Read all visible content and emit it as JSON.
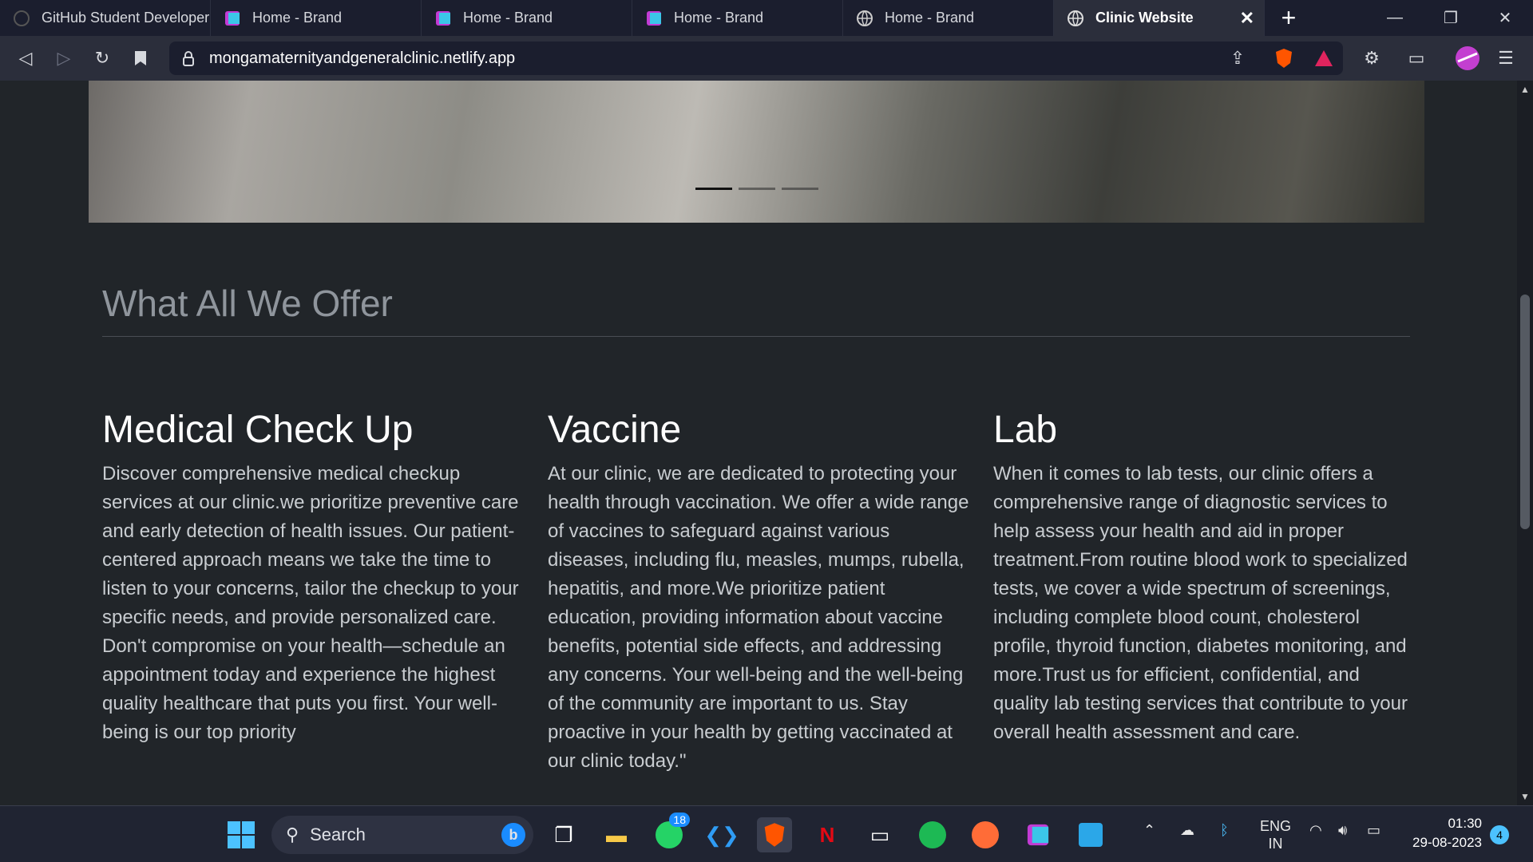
{
  "browser": {
    "tabs": [
      {
        "title": "GitHub Student Developer",
        "favicon": "github-icon",
        "active": false
      },
      {
        "title": "Home - Brand",
        "favicon": "brand-icon",
        "active": false
      },
      {
        "title": "Home - Brand",
        "favicon": "brand-icon",
        "active": false
      },
      {
        "title": "Home - Brand",
        "favicon": "brand-icon",
        "active": false
      },
      {
        "title": "Home - Brand",
        "favicon": "globe-icon",
        "active": false
      },
      {
        "title": "Clinic Website",
        "favicon": "globe-icon",
        "active": true
      }
    ],
    "new_tab": "+",
    "url": "mongamaternityandgeneralclinic.netlify.app",
    "accent": "#ff5500"
  },
  "page": {
    "offer_title": "What All We Offer",
    "services": [
      {
        "title": "Medical Check Up",
        "text": "Discover comprehensive medical checkup services at our clinic.we prioritize preventive care and early detection of health issues. Our patient-centered approach means we take the time to listen to your concerns, tailor the checkup to your specific needs, and provide personalized care. Don't compromise on your health—schedule an appointment today and experience the highest quality healthcare that puts you first. Your well-being is our top priority"
      },
      {
        "title": "Vaccine",
        "text": "At our clinic, we are dedicated to protecting your health through vaccination. We offer a wide range of vaccines to safeguard against various diseases, including flu, measles, mumps, rubella, hepatitis, and more.We prioritize patient education, providing information about vaccine benefits, potential side effects, and addressing any concerns. Your well-being and the well-being of the community are important to us. Stay proactive in your health by getting vaccinated at our clinic today.\""
      },
      {
        "title": "Lab",
        "text": "When it comes to lab tests, our clinic offers a comprehensive range of diagnostic services to help assess your health and aid in proper treatment.From routine blood work to specialized tests, we cover a wide spectrum of screenings, including complete blood count, cholesterol profile, thyroid function, diabetes monitoring, and more.Trust us for efficient, confidential, and quality lab testing services that contribute to your overall health assessment and care."
      }
    ]
  },
  "taskbar": {
    "search_label": "Search",
    "whatsapp_badge": "18",
    "lang_line1": "ENG",
    "lang_line2": "IN",
    "time": "01:30",
    "date": "29-08-2023",
    "notification_count": "4"
  }
}
